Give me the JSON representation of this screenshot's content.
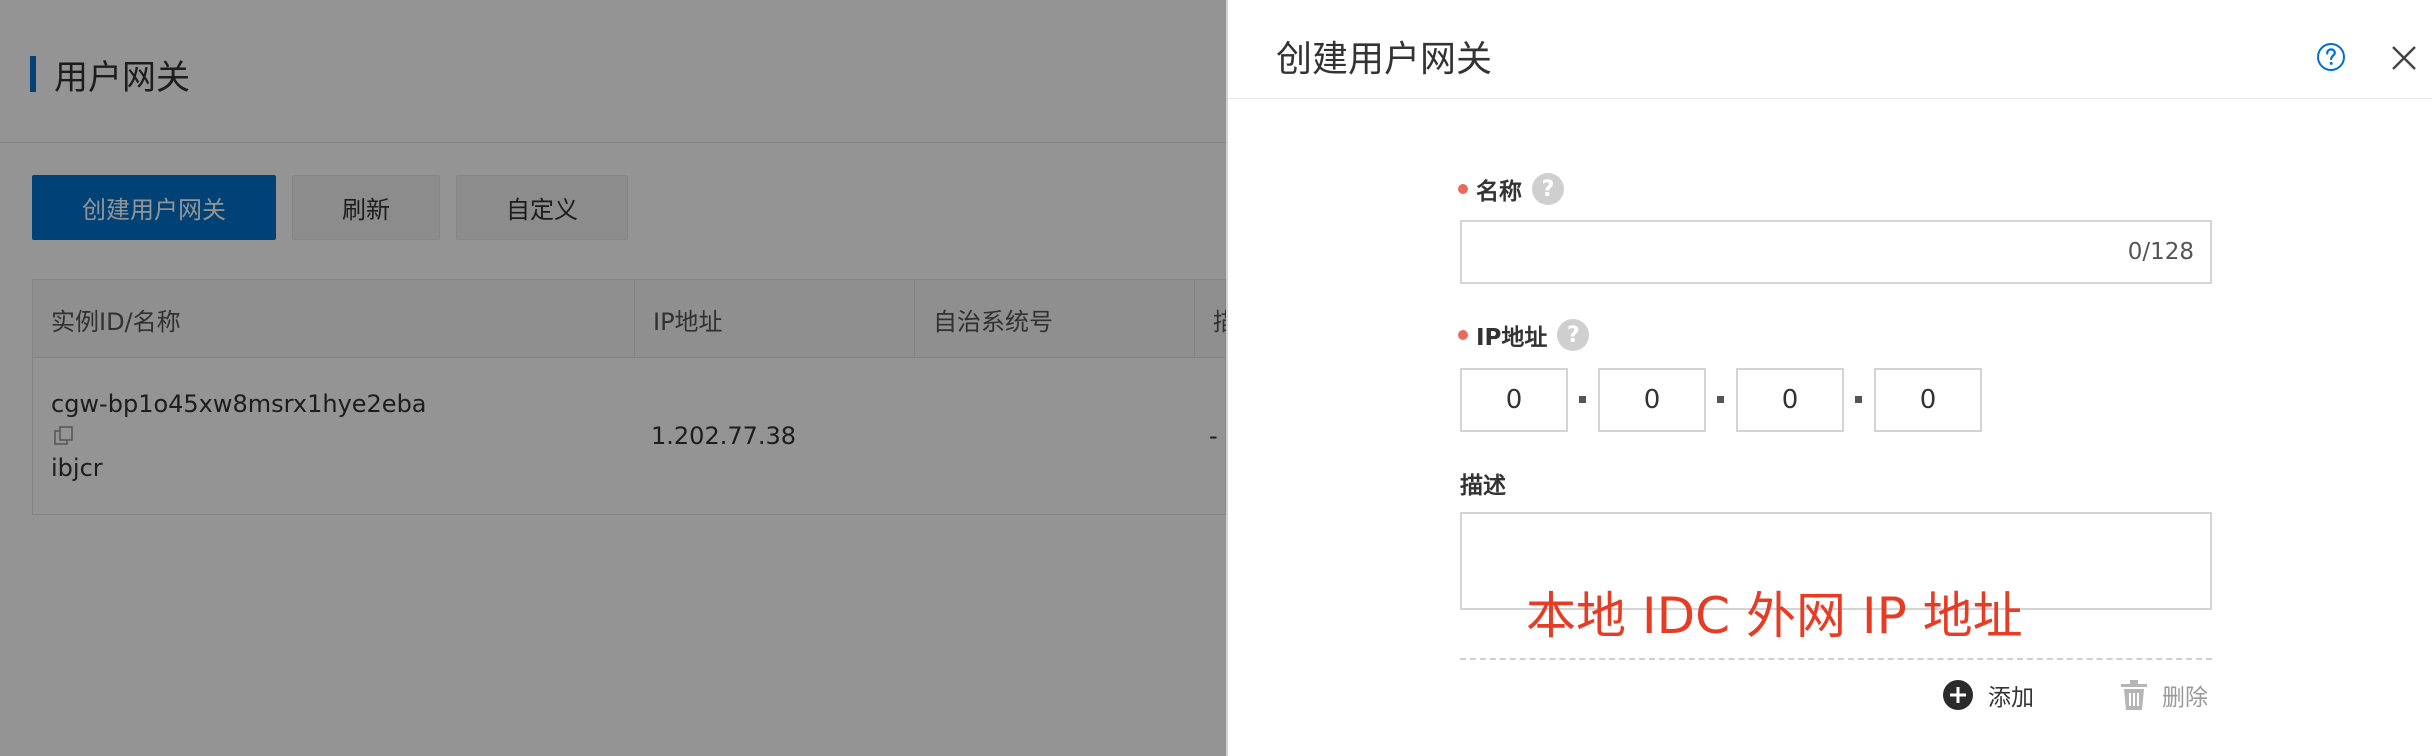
{
  "background_page": {
    "title": "用户网关",
    "buttons": {
      "create": "创建用户网关",
      "refresh": "刷新",
      "customize": "自定义"
    },
    "table": {
      "headers": [
        "实例ID/名称",
        "IP地址",
        "自治系统号",
        "描"
      ],
      "rows": [
        {
          "instance_id": "cgw-bp1o45xw8msrx1hye2eba",
          "name": "ibjcr",
          "ip": "1.202.77.38",
          "asn": "",
          "desc": "-"
        }
      ]
    }
  },
  "drawer": {
    "title": "创建用户网关",
    "help_icon": "question-circle-icon",
    "close_icon": "close-icon",
    "name_field": {
      "label": "名称",
      "value": "",
      "counter": "0/128"
    },
    "ip_field": {
      "label": "IP地址",
      "octets": [
        "0",
        "0",
        "0",
        "0"
      ]
    },
    "description_field": {
      "label": "描述",
      "value": ""
    },
    "annotation": "本地 IDC 外网 IP 地址",
    "actions": {
      "add": "添加",
      "delete": "删除"
    }
  },
  "colors": {
    "primary": "#0070cc",
    "required_dot": "#e86a5a",
    "annotation": "#e63b24",
    "overlay": "rgba(0,0,0,0.42)"
  }
}
